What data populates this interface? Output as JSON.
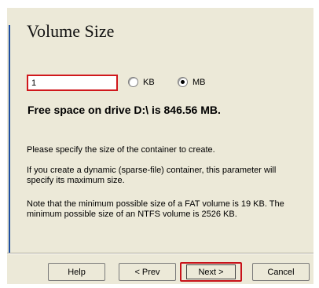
{
  "dialog": {
    "title": "Volume Size"
  },
  "size": {
    "value": "1",
    "unit_kb": "KB",
    "unit_mb": "MB",
    "selected_unit": "MB"
  },
  "free_space": "Free space on drive D:\\ is 846.56 MB.",
  "help": {
    "p1": "Please specify the size of the container to create.",
    "p2": "If you create a dynamic (sparse-file) container, this parameter will specify its maximum size.",
    "p3": "Note that the minimum possible size of a FAT volume is 19 KB. The minimum possible size of an NTFS volume is 2526 KB."
  },
  "buttons": {
    "help": "Help",
    "prev": "< Prev",
    "next": "Next >",
    "cancel": "Cancel"
  },
  "colors": {
    "highlight": "#d0181c",
    "dialog_bg": "#ece9d8",
    "accent": "#1f4ea0"
  }
}
